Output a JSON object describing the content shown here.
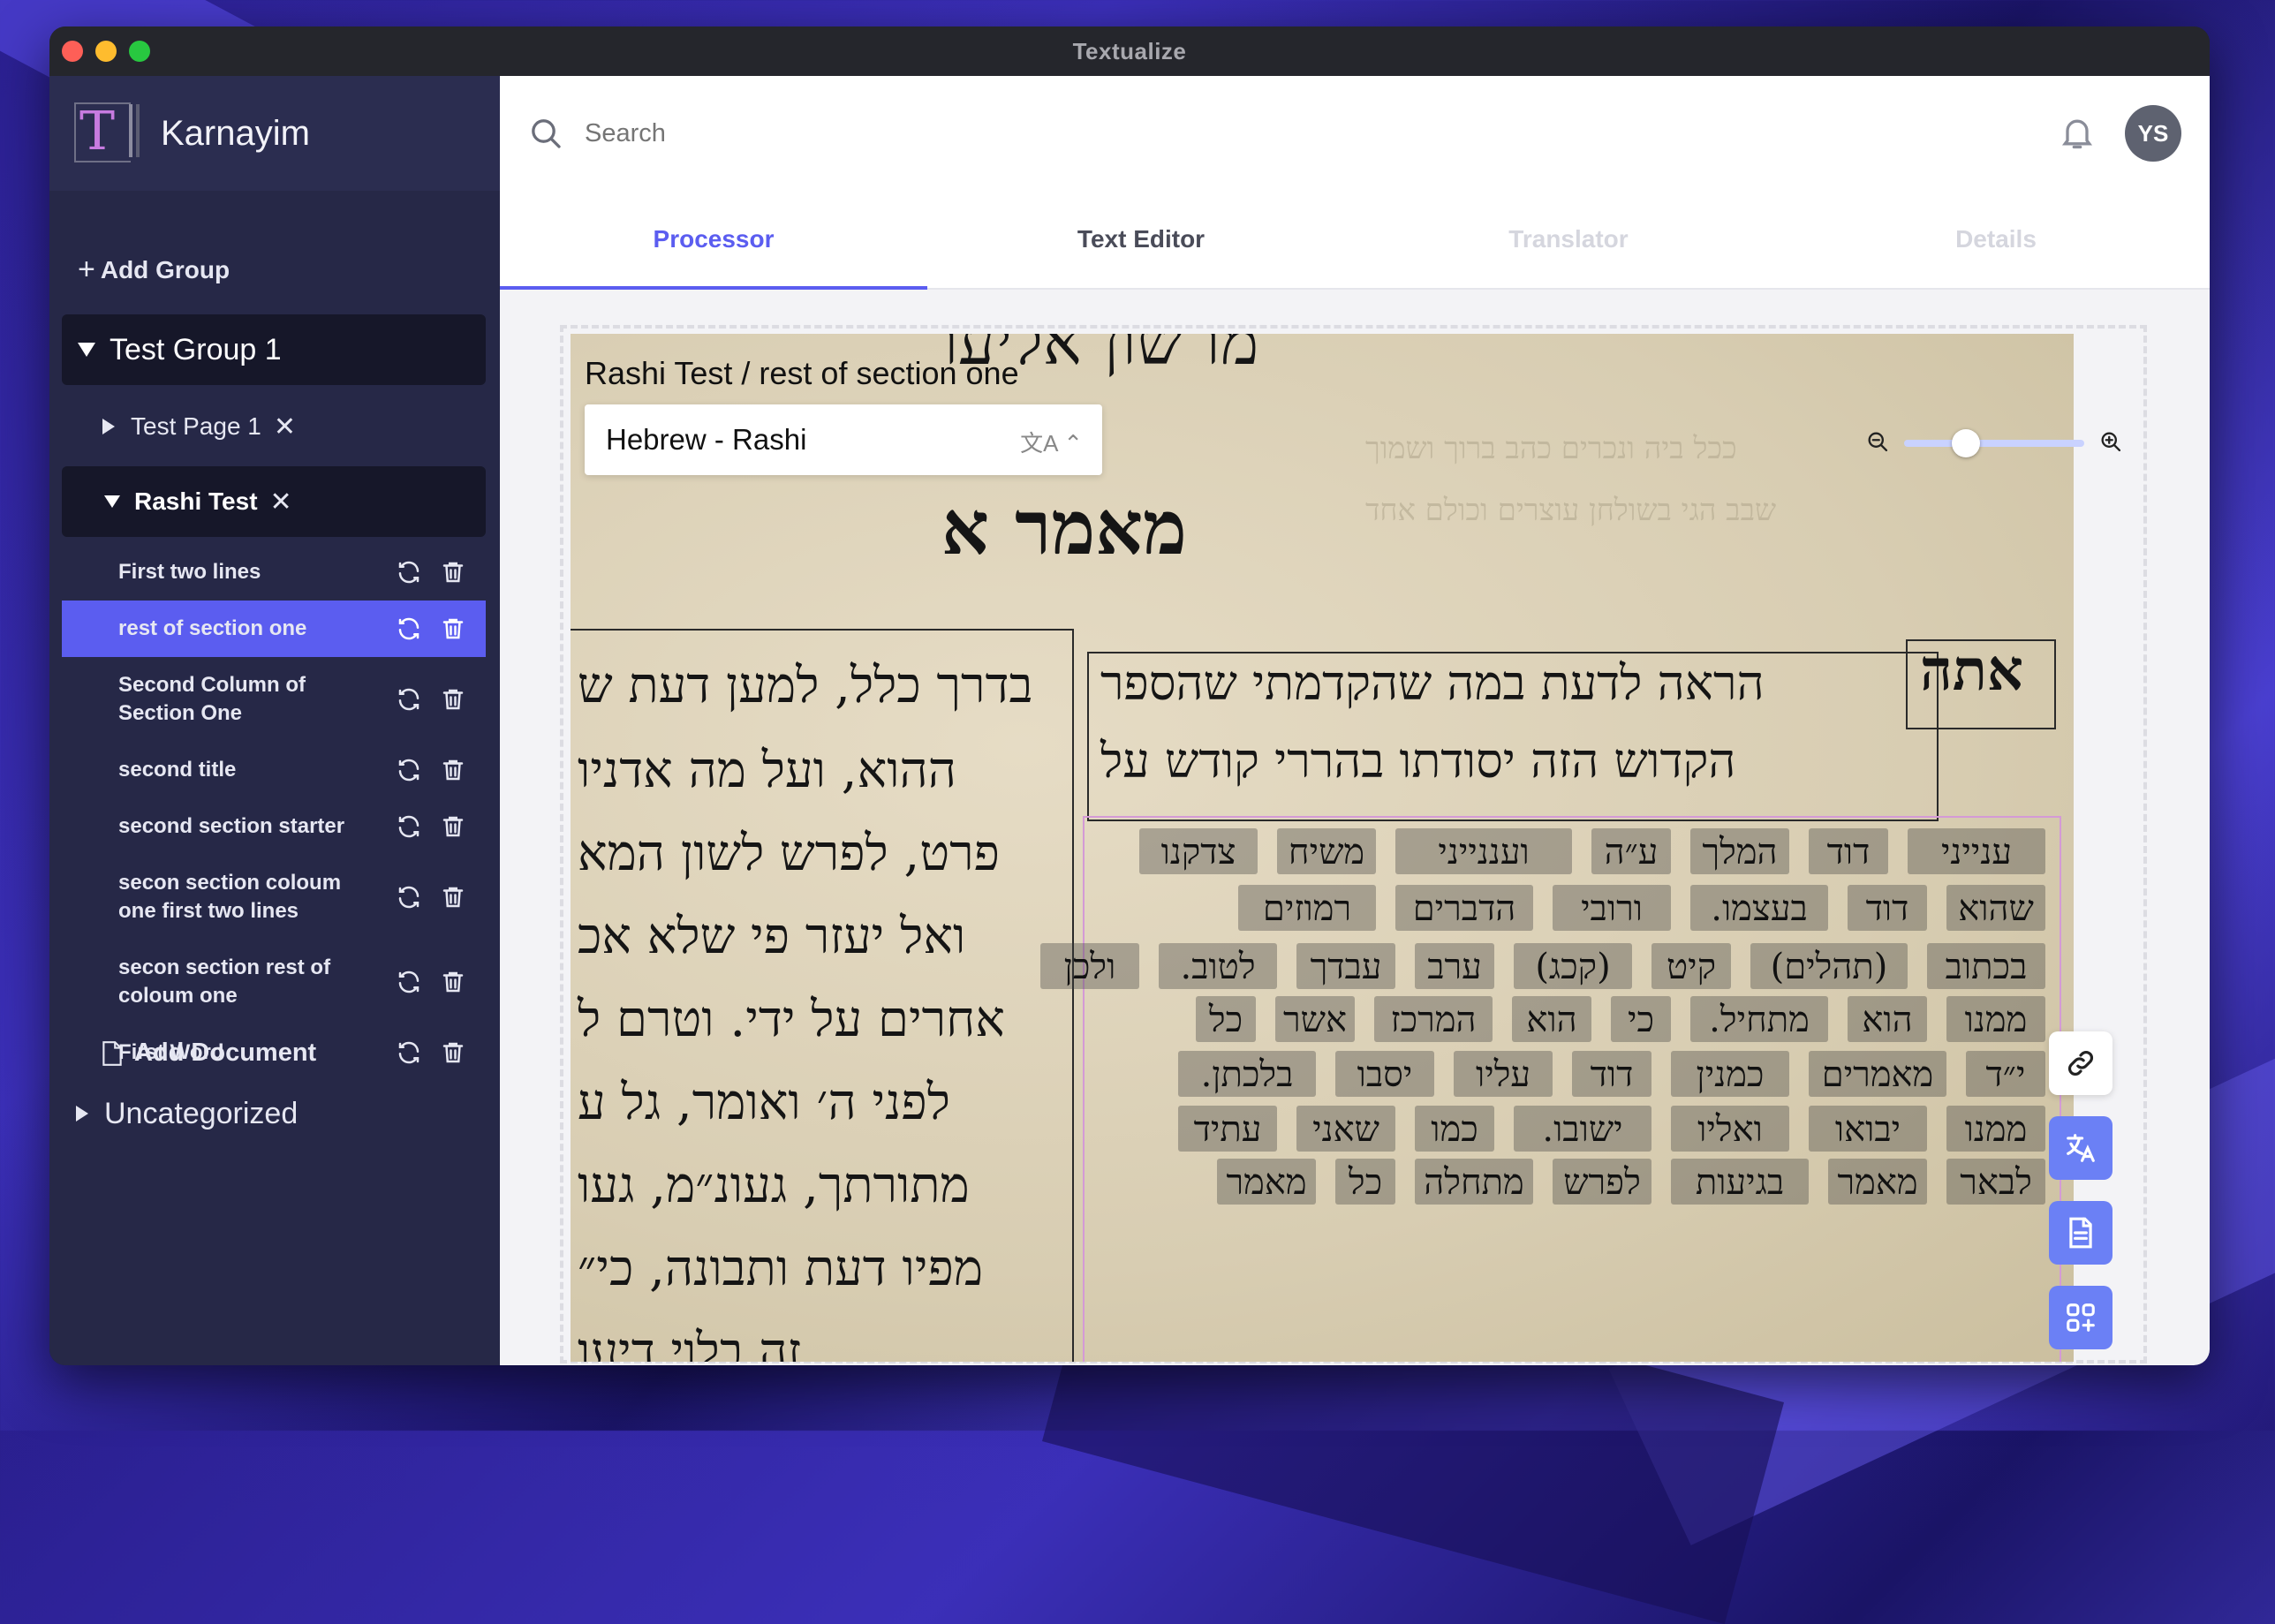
{
  "window": {
    "title": "Textualize"
  },
  "sidebar": {
    "brand": "Karnayim",
    "add_group": "Add Group",
    "group": {
      "label": "Test Group 1"
    },
    "pages": [
      {
        "label": "Test Page 1"
      },
      {
        "label": "Rashi Test"
      }
    ],
    "documents": [
      {
        "label": "First two lines"
      },
      {
        "label": "rest of section one"
      },
      {
        "label": "Second Column of Section One"
      },
      {
        "label": "second title"
      },
      {
        "label": "second section starter"
      },
      {
        "label": "secon section coloum one first two lines"
      },
      {
        "label": "secon section rest of coloum one"
      },
      {
        "label": "First Word"
      }
    ],
    "add_document": "Add Document",
    "uncategorized": "Uncategorized"
  },
  "topbar": {
    "search_placeholder": "Search",
    "avatar_initials": "YS"
  },
  "tabs": [
    "Processor",
    "Text Editor",
    "Translator",
    "Details"
  ],
  "processor": {
    "title": "Rashi Test / rest of section one",
    "language": "Hebrew - Rashi",
    "zoom_level": 0.1
  },
  "image_text": {
    "top_heading": "מו שון אליעו",
    "heading": "מאמר א",
    "first_word": "אתה",
    "right_lines": [
      "הראה לדעת במה שהקדמתי שהספר",
      "הקדוש הזה יסודתו בהררי קודש על"
    ],
    "left_lines": [
      "בדרך כלל, למען דעת ש",
      "ההוא, ועל מה אדניו",
      "פרט, לפרש לשון המא",
      "ואל יעזר פי שלא אכ",
      "אחרים על ידי. וטרם ל",
      "לפני ה׳ ואומר, גל ע",
      "מתורתך, געונ״מ, געו",
      "מפיו דעת ותבונה, כי״",
      "זה בלוי דיעו"
    ],
    "words": [
      [
        "ענייני",
        "דוד",
        "המלך",
        "ע״ה",
        "ועננייני",
        "משיח",
        "צדקנו"
      ],
      [
        "שהוא",
        "דוד",
        "בעצמו.",
        "ורובי",
        "הדברים",
        "רמוזים"
      ],
      [
        "בכתוב",
        "(תהלים)",
        "קיט",
        "(קכג)",
        "ערב",
        "עבדך",
        "לטוב.",
        "ולכן"
      ],
      [
        "ממנו",
        "הוא",
        "מתחיל.",
        "כי",
        "הוא",
        "המרכז",
        "אשר",
        "כל"
      ],
      [
        "י״ד",
        "מאמרים",
        "כמנין",
        "דוד",
        "עליו",
        "יסבו",
        "בלכתן."
      ],
      [
        "ממנו",
        "יבואו",
        "ואליו",
        "ישובו.",
        "כמו",
        "שאני",
        "עתיד"
      ],
      [
        "לבאר",
        "מאמר",
        "בגיעות",
        "לפרש",
        "מתחלה",
        "כל",
        "מאמר"
      ]
    ]
  }
}
